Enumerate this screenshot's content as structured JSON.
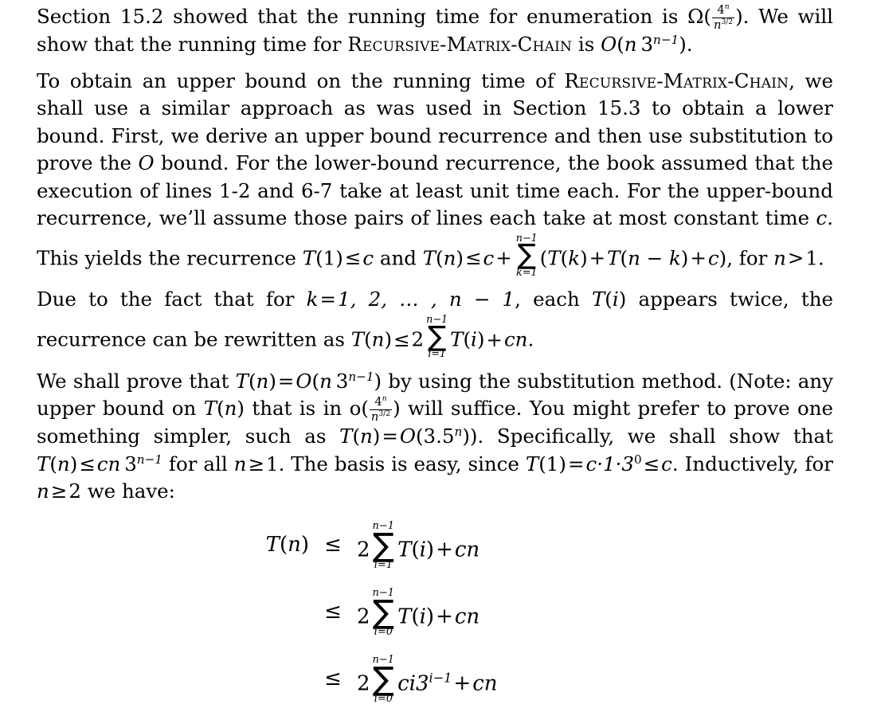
{
  "document": {
    "type": "textbook-solution-page",
    "background_color": "#ffffff",
    "text_color": "#000000"
  },
  "paragraphs": {
    "p1": {
      "s1": "Section 15.2 showed that the running time for enumeration is ",
      "omega": "Ω",
      "lparen": "(",
      "frac_num": "4",
      "frac_num_exp": "n",
      "frac_den": "n",
      "frac_den_exp": "3/2",
      "rparen": ")",
      "s2": ". We will show that the running time for ",
      "algo": "Recursive-Matrix-Chain",
      "s3": " is ",
      "bigO": "O",
      "bigO_open": "(",
      "bigO_n": "n",
      "bigO_three": "3",
      "bigO_exp": "n−1",
      "bigO_close": ")",
      "s4": "."
    },
    "p2": {
      "s1": "To obtain an upper bound on the running time of ",
      "algo": "Recursive-Matrix-Chain",
      "s2": ", we shall use a similar approach as was used in Section 15.3 to obtain a lower bound. First, we derive an upper bound recurrence and then use substitution to prove the ",
      "bigO": "O",
      "s3": " bound. For the lower-bound recurrence, the book assumed that the execution of lines 1-2 and 6-7 take at least unit time each. For the upper-bound recurrence, we’ll assume those pairs of lines each take at most constant time ",
      "c": "c",
      "s4": ". This yields the recurrence ",
      "T1": "T",
      "T1_open": "(",
      "T1_arg": "1",
      "T1_close": ")",
      "le1": "≤",
      "c2": "c",
      "s5": " and ",
      "Tn": "T",
      "Tn_open": "(",
      "Tn_arg": "n",
      "Tn_close": ")",
      "le2": "≤",
      "c3": "c",
      "plus1": "+",
      "sum_upper": "n−1",
      "sum_sigma": "∑",
      "sum_lower": "k=1",
      "body_open": "(",
      "body_T_k": "T",
      "body_k_open": "(",
      "body_k": "k",
      "body_k_close": ")",
      "body_plus": "+",
      "body_T_nk": "T",
      "body_nk_open": "(",
      "body_nk": "n − k",
      "body_nk_close": ")",
      "body_plus2": "+",
      "body_c": "c",
      "body_close": ")",
      "s6": ", for ",
      "n_var": "n",
      "gt": ">",
      "one": "1",
      "s7": "."
    },
    "p3": {
      "s1": "Due to the fact that for ",
      "k": "k",
      "eq": "=",
      "range": "1, 2, … , n − 1",
      "s2": ", each ",
      "Ti": "T",
      "Ti_open": "(",
      "Ti_arg": "i",
      "Ti_close": ")",
      "s3": " appears twice, the recurrence can be rewritten as ",
      "Tn": "T",
      "Tn_open": "(",
      "Tn_arg": "n",
      "Tn_close": ")",
      "le": "≤",
      "two": "2",
      "sum_upper": "n−1",
      "sum_sigma": "∑",
      "sum_lower": "i=1",
      "Ti2": "T",
      "Ti2_open": "(",
      "Ti2_arg": "i",
      "Ti2_close": ")",
      "plus": "+",
      "cn": "cn",
      "s4": "."
    },
    "p4": {
      "s1": "We shall prove that ",
      "Tn": "T",
      "Tn_open": "(",
      "Tn_arg": "n",
      "Tn_close": ")",
      "eq1": "=",
      "bigO": "O",
      "bigO_open": "(",
      "bigO_n": "n",
      "bigO_three": "3",
      "bigO_exp": "n−1",
      "bigO_close": ")",
      "s2": " by using the substitution method. (Note: any upper bound on ",
      "Tn2": "T",
      "Tn2_open": "(",
      "Tn2_arg": "n",
      "Tn2_close": ")",
      "s3": " that is in o",
      "o_open": "(",
      "frac_num": "4",
      "frac_num_exp": "n",
      "frac_den": "n",
      "frac_den_exp": "3/2",
      "o_close": ")",
      "s4": " will suffice. You might prefer to prove one something simpler, such as ",
      "Tn3": "T",
      "Tn3_open": "(",
      "Tn3_arg": "n",
      "Tn3_close": ")",
      "eq2": "=",
      "bigO2": "O",
      "bigO2_open": "(",
      "bigO2_val": "3.5",
      "bigO2_exp": "n",
      "bigO2_close": ")",
      "s5": "). Specifically, we shall show that ",
      "Tn4": "T",
      "Tn4_open": "(",
      "Tn4_arg": "n",
      "Tn4_close": ")",
      "le1": "≤",
      "cn": "cn",
      "three": "3",
      "three_exp": "n−1",
      "s6": " for all ",
      "n_var": "n",
      "ge1": "≥",
      "one": "1",
      "s7": ". The basis is easy, since ",
      "T1": "T",
      "T1_open": "(",
      "T1_arg": "1",
      "T1_close": ")",
      "eq3": "=",
      "basis": "c·1·3",
      "basis_exp": "0",
      "le2": "≤",
      "c": "c",
      "s8": ". Inductively, for ",
      "n_var2": "n",
      "ge2": "≥",
      "two": "2",
      "s9": " we have:"
    }
  },
  "display_equations": {
    "rows": [
      {
        "lhs": "T(n)",
        "lhs_fn": "T",
        "lhs_open": "(",
        "lhs_arg": "n",
        "lhs_close": ")",
        "relation": "≤",
        "coefficient": "2",
        "sum_upper": "n−1",
        "sum_sigma": "∑",
        "sum_lower": "i=1",
        "term_fn": "T",
        "term_open": "(",
        "term_arg": "i",
        "term_close": ")",
        "term_exp": "",
        "plus": "+",
        "tail": "cn"
      },
      {
        "lhs": "",
        "lhs_fn": "",
        "lhs_open": "",
        "lhs_arg": "",
        "lhs_close": "",
        "relation": "≤",
        "coefficient": "2",
        "sum_upper": "n−1",
        "sum_sigma": "∑",
        "sum_lower": "i=0",
        "term_fn": "T",
        "term_open": "(",
        "term_arg": "i",
        "term_close": ")",
        "term_exp": "",
        "plus": "+",
        "tail": "cn"
      },
      {
        "lhs": "",
        "lhs_fn": "",
        "lhs_open": "",
        "lhs_arg": "",
        "lhs_close": "",
        "relation": "≤",
        "coefficient": "2",
        "sum_upper": "n−1",
        "sum_sigma": "∑",
        "sum_lower": "i=0",
        "term_fn": "ci3",
        "term_open": "",
        "term_arg": "",
        "term_close": "",
        "term_exp": "i−1",
        "plus": "+",
        "tail": "cn"
      }
    ]
  }
}
